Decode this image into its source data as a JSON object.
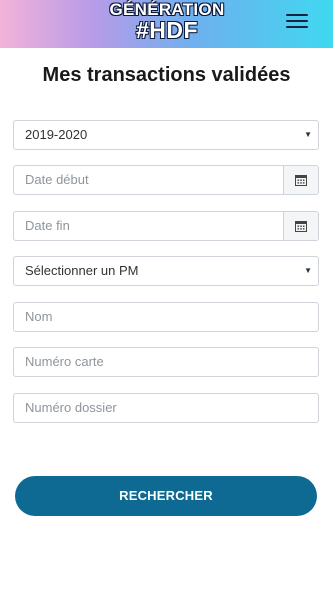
{
  "header": {
    "logo_line1": "GÉNÉRATION",
    "logo_line2": "#HDF",
    "menu_icon": "hamburger-icon"
  },
  "page": {
    "title": "Mes transactions validées"
  },
  "form": {
    "year_select": {
      "value": "2019-2020"
    },
    "date_start": {
      "placeholder": "Date début",
      "icon": "calendar-icon"
    },
    "date_end": {
      "placeholder": "Date fin",
      "icon": "calendar-icon"
    },
    "pm_select": {
      "value": "Sélectionner un PM"
    },
    "name": {
      "placeholder": "Nom"
    },
    "card_number": {
      "placeholder": "Numéro carte"
    },
    "file_number": {
      "placeholder": "Numéro dossier"
    },
    "search_label": "RECHERCHER"
  },
  "colors": {
    "button": "#0e6a92",
    "border": "#cfd4da",
    "title": "#1a1a1a"
  }
}
